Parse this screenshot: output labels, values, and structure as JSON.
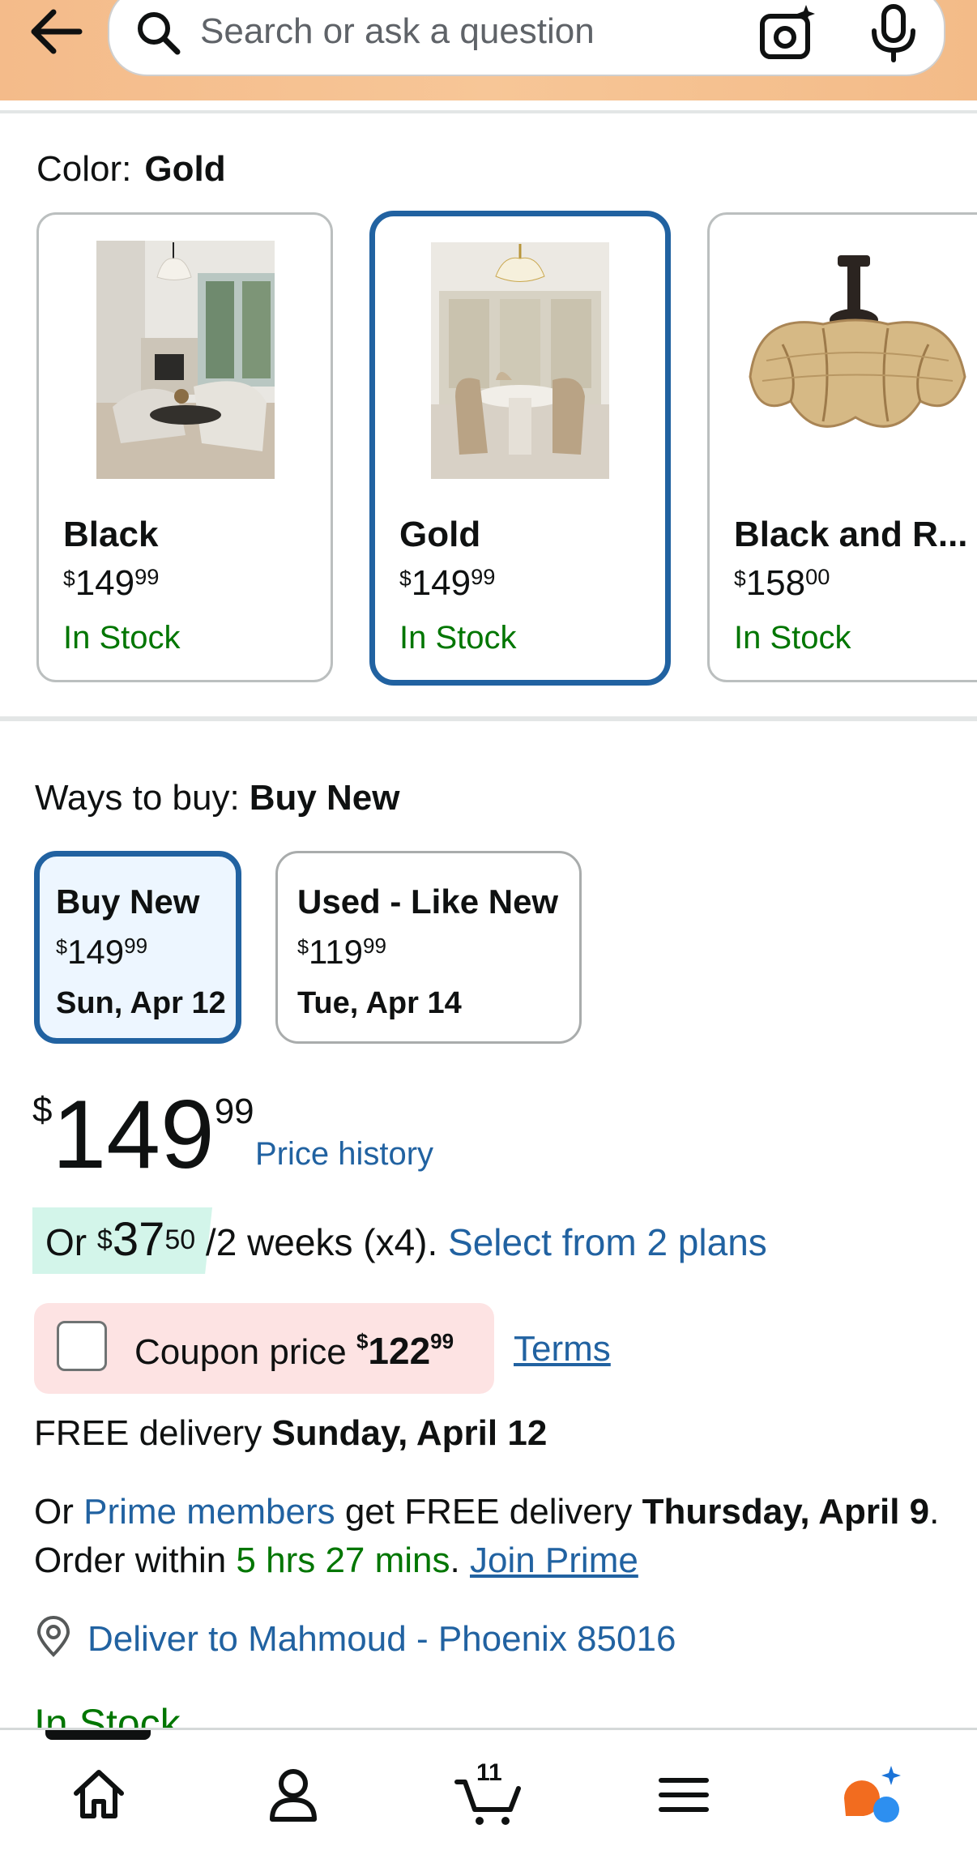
{
  "search": {
    "placeholder": "Search or ask a question"
  },
  "color_selector": {
    "label": "Color:",
    "selected": "Gold",
    "options": [
      {
        "name": "Black",
        "price_whole": "149",
        "price_frac": "99",
        "currency": "$",
        "stock": "In Stock"
      },
      {
        "name": "Gold",
        "price_whole": "149",
        "price_frac": "99",
        "currency": "$",
        "stock": "In Stock"
      },
      {
        "name": "Black and R...",
        "price_whole": "158",
        "price_frac": "00",
        "currency": "$",
        "stock": "In Stock"
      }
    ]
  },
  "ways_to_buy": {
    "label": "Ways to buy:",
    "selected": "Buy New",
    "options": [
      {
        "title": "Buy New",
        "currency": "$",
        "price_whole": "149",
        "price_frac": "99",
        "date": "Sun, Apr 12"
      },
      {
        "title": "Used - Like New",
        "currency": "$",
        "price_whole": "119",
        "price_frac": "99",
        "date": "Tue, Apr 14"
      }
    ]
  },
  "price": {
    "currency": "$",
    "whole": "149",
    "frac": "99",
    "history_link": "Price history"
  },
  "installment": {
    "prefix": "Or ",
    "currency": "$",
    "whole": "37",
    "frac": "50",
    "suffix": " /2 weeks (x4). ",
    "plans_link": "Select from 2 plans"
  },
  "coupon": {
    "label": "Coupon price ",
    "currency": "$",
    "whole": "122",
    "frac": "99",
    "terms": "Terms",
    "checked": false
  },
  "delivery": {
    "free_prefix": "FREE delivery ",
    "free_date": "Sunday, April 12",
    "prime_or": "Or ",
    "prime_members": "Prime members",
    "prime_mid": " get FREE delivery ",
    "prime_date": "Thursday, April 9",
    "order_within": ". Order within ",
    "countdown": "5 hrs 27 mins",
    "period": ". ",
    "join_prime": "Join Prime",
    "deliver_to": "Deliver to Mahmoud - Phoenix 85016"
  },
  "availability": "In Stock",
  "bottom_nav": {
    "cart_count": "11",
    "items": [
      "home-icon",
      "account-icon",
      "cart-icon",
      "menu-icon",
      "rufus-ai-icon"
    ]
  },
  "colors": {
    "link": "#2162a1",
    "stock_green": "#007600",
    "selected_border": "#2162a1",
    "header": "#f6c394"
  }
}
